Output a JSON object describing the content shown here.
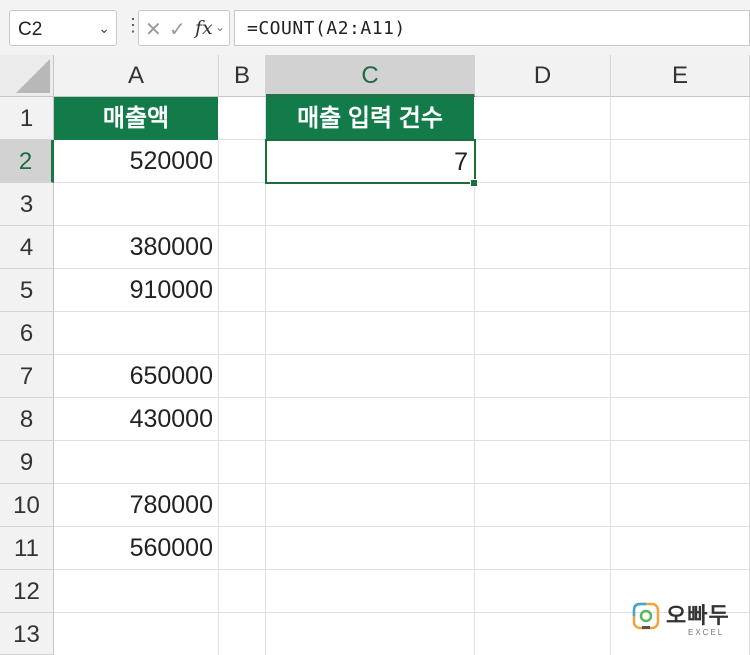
{
  "formula_bar": {
    "name_box": "C2",
    "formula": "=COUNT(A2:A11)",
    "fx_label": "fx"
  },
  "columns": [
    "A",
    "B",
    "C",
    "D",
    "E"
  ],
  "rows": [
    "1",
    "2",
    "3",
    "4",
    "5",
    "6",
    "7",
    "8",
    "9",
    "10",
    "11",
    "12",
    "13"
  ],
  "cells": {
    "A1": "매출액",
    "C1": "매출 입력 건수",
    "A2": "520000",
    "C2": "7",
    "A4": "380000",
    "A5": "910000",
    "A7": "650000",
    "A8": "430000",
    "A10": "780000",
    "A11": "560000"
  },
  "logo": {
    "name": "오빠두",
    "sub": "EXCEL"
  },
  "colors": {
    "header_fill": "#137a4a",
    "accent": "#217346"
  }
}
